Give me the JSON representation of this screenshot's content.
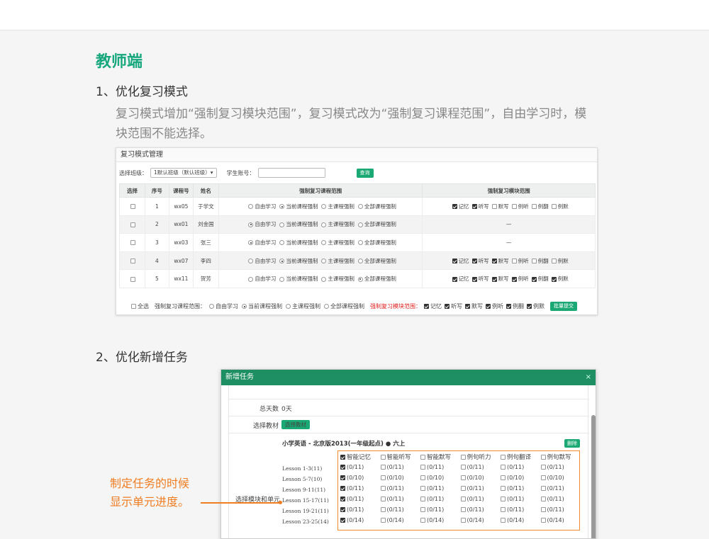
{
  "heading": "教师端",
  "section1": {
    "title": "1、优化复习模式",
    "desc": "复习模式增加“强制复习模块范围”，复习模式改为“强制复习课程范围”，自由学习时，模块范围不能选择。"
  },
  "shot1": {
    "title": "复习模式管理",
    "class_label": "选择班级：",
    "class_value": "1默认班级（默认班级）▾",
    "account_label": "学生账号：",
    "query": "查询",
    "headers": [
      "选择",
      "序号",
      "课程号",
      "姓名",
      "强制复习课程范围",
      "强制复习模块范围"
    ],
    "course_opts": [
      "自由学习",
      "当前课程强制",
      "主课程强制",
      "全部课程强制"
    ],
    "rows": [
      {
        "no": "1",
        "code": "wx05",
        "name": "于学文",
        "sel": 1,
        "mods": [
          1,
          1,
          0,
          0,
          0,
          0
        ],
        "dash": false
      },
      {
        "no": "2",
        "code": "wx01",
        "name": "刘金国",
        "sel": 0,
        "mods": [],
        "dash": true
      },
      {
        "no": "3",
        "code": "wx03",
        "name": "张三",
        "sel": 0,
        "mods": [],
        "dash": true
      },
      {
        "no": "4",
        "code": "wx07",
        "name": "李四",
        "sel": 1,
        "mods": [
          1,
          1,
          1,
          0,
          0,
          0
        ],
        "dash": false
      },
      {
        "no": "5",
        "code": "wx11",
        "name": "贺芳",
        "sel": 3,
        "mods": [
          1,
          1,
          1,
          1,
          1,
          1
        ],
        "dash": false
      }
    ],
    "dash": "—",
    "module_opts": [
      "记忆",
      "听写",
      "默写",
      "例听",
      "例翻",
      "例默"
    ],
    "bottom": {
      "select_all": "全选",
      "course_label": "强制复习课程范围：",
      "course_opts": [
        "自由学习",
        "当前课程强制",
        "主课程强制",
        "全部课程强制"
      ],
      "module_label": "强制复习模块范围：",
      "module_opts": [
        "记忆",
        "听写",
        "默写",
        "例听",
        "例翻",
        "例默"
      ],
      "submit": "批量提交"
    }
  },
  "section2": {
    "title": "2、优化新增任务"
  },
  "shot2": {
    "title": "新增任务",
    "close": "×",
    "days_label": "总天数",
    "days_value": "0天",
    "material_label": "选择教材",
    "material_button": "选择教材",
    "module_label": "选择模块和单元",
    "book_title": "小学英语 - 北京版2013(一年级起点) ● 六上",
    "delete": "删除",
    "module_headers": [
      "智能记忆",
      "智能听写",
      "智能默写",
      "例句听力",
      "例句翻译",
      "例句默写"
    ],
    "lessons": [
      {
        "name": "Lesson 1-3(11)",
        "vals": [
          "(0/11)",
          "(0/11)",
          "(0/11)",
          "(0/11)",
          "(0/11)",
          "(0/11)"
        ],
        "on": true
      },
      {
        "name": "Lesson 5-7(10)",
        "vals": [
          "(0/10)",
          "(0/10)",
          "(0/10)",
          "(0/10)",
          "(0/10)",
          "(0/10)"
        ],
        "on": true
      },
      {
        "name": "Lesson 9-11(11)",
        "vals": [
          "(0/11)",
          "(0/11)",
          "(0/11)",
          "(0/11)",
          "(0/11)",
          "(0/11)"
        ],
        "on": true
      },
      {
        "name": "Lesson 15-17(11)",
        "vals": [
          "(0/11)",
          "(0/11)",
          "(0/11)",
          "(0/11)",
          "(0/11)",
          "(0/11)"
        ],
        "on": true
      },
      {
        "name": "Lesson 19-21(11)",
        "vals": [
          "(0/11)",
          "(0/11)",
          "(0/11)",
          "(0/11)",
          "(0/11)",
          "(0/11)"
        ],
        "on": true
      },
      {
        "name": "Lesson 23-25(14)",
        "vals": [
          "(0/14)",
          "(0/14)",
          "(0/14)",
          "(0/14)",
          "(0/14)",
          "(0/14)"
        ],
        "on": true
      }
    ]
  },
  "note": {
    "line1": "制定任务的时候",
    "line2": "显示单元进度。"
  }
}
